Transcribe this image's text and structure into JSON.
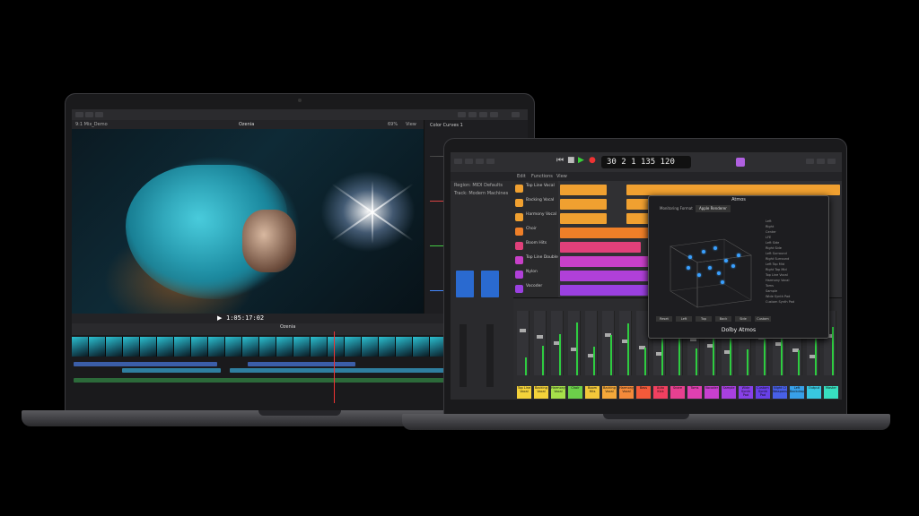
{
  "fcp": {
    "library_label": "9:1 Mix_Demo",
    "viewer_label": "Ozenia",
    "zoom": "69%",
    "view_label": "View",
    "inspector_title": "Color Curves 1",
    "timecode": "1:05:17:02",
    "timeline_label": "Ozenia",
    "accent": "#2bb5c8"
  },
  "logic": {
    "lcd": {
      "bar": "30",
      "beat": "2",
      "division": "1",
      "tick": "135",
      "tempo": "120"
    },
    "region_label": "Region: MIDI Defaults",
    "track_label": "Track: Modern Machines",
    "menu": [
      "Edit",
      "Functions",
      "View"
    ],
    "tracks": [
      {
        "name": "Top Line Vocal",
        "color": "#f0a030"
      },
      {
        "name": "Backing Vocal",
        "color": "#f0a030"
      },
      {
        "name": "Harmony Vocal",
        "color": "#f0a030"
      },
      {
        "name": "Choir",
        "color": "#ef7f28"
      },
      {
        "name": "Boom Hits",
        "color": "#e0407a"
      },
      {
        "name": "Top Line Double",
        "color": "#c840c8"
      },
      {
        "name": "Nylon",
        "color": "#b040d8"
      },
      {
        "name": "Vocoder",
        "color": "#9a40e0"
      }
    ],
    "dolby_window": {
      "title": "Atmos",
      "monitoring_label": "Monitoring Format",
      "renderer": "Apple Renderer",
      "footer": "Dolby Atmos",
      "buttons": [
        "Reset",
        "Left",
        "Top",
        "Back",
        "Side",
        "Custom"
      ],
      "objects": [
        "Left",
        "Right",
        "Center",
        "LFE",
        "Left Side",
        "Right Side",
        "Left Surround",
        "Right Surround",
        "Left Top Mid",
        "Right Top Mid",
        "Top Line Vocal",
        "Harmony Vocal",
        "Toms",
        "Sample",
        "Wide Synth Pad",
        "Custom Synth Pad"
      ]
    },
    "channels": [
      {
        "name": "Top Line Vocal",
        "color": "#f4d23a"
      },
      {
        "name": "Backing Vocal",
        "color": "#f4d23a"
      },
      {
        "name": "Harmony Vocal",
        "color": "#a6e04a"
      },
      {
        "name": "Choir",
        "color": "#6cd04a"
      },
      {
        "name": "Boom Hits",
        "color": "#f4c83a"
      },
      {
        "name": "Backing Vocal",
        "color": "#f4a83a"
      },
      {
        "name": "Harmony Vocal",
        "color": "#f48a3a"
      },
      {
        "name": "Bass",
        "color": "#f45a3a"
      },
      {
        "name": "Auto Kick",
        "color": "#f04060"
      },
      {
        "name": "Snare",
        "color": "#e84090"
      },
      {
        "name": "Toms",
        "color": "#e040b0"
      },
      {
        "name": "Vocoder",
        "color": "#c840d0"
      },
      {
        "name": "Sample",
        "color": "#a840e0"
      },
      {
        "name": "Wide Synth Pad",
        "color": "#8840e8"
      },
      {
        "name": "Custom Synth Pad",
        "color": "#6840e8"
      },
      {
        "name": "Night Cl Weapons",
        "color": "#4860e8"
      },
      {
        "name": "Left Backdrop",
        "color": "#38a0e8"
      },
      {
        "name": "Output",
        "color": "#38c8e0"
      },
      {
        "name": "Master",
        "color": "#38e0c0"
      }
    ]
  }
}
